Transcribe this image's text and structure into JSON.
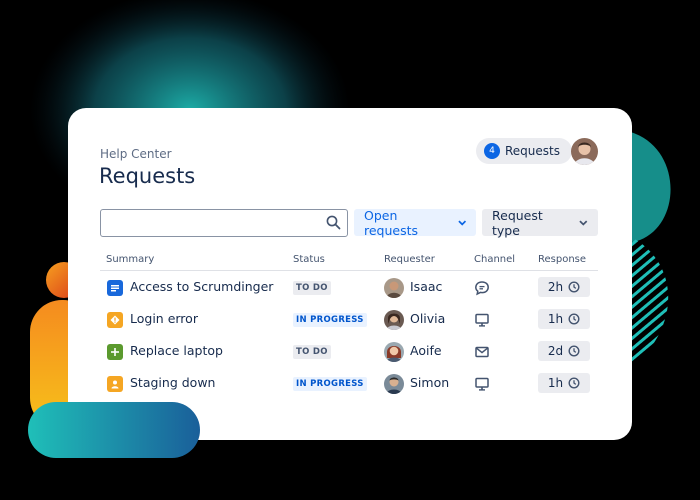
{
  "header": {
    "breadcrumb": "Help Center",
    "title": "Requests",
    "requests_count": "4",
    "requests_label": "Requests"
  },
  "filters": {
    "search_placeholder": "",
    "open_requests": "Open requests",
    "request_type": "Request type"
  },
  "table": {
    "columns": {
      "summary": "Summary",
      "status": "Status",
      "requester": "Requester",
      "channel": "Channel",
      "response": "Response"
    },
    "rows": [
      {
        "summary": "Access to Scrumdinger",
        "type_icon": "service-request-icon",
        "type_color": "#1868db",
        "status": "TO DO",
        "status_kind": "todo",
        "requester": "Isaac",
        "channel": "chat-icon",
        "response": "2h"
      },
      {
        "summary": "Login error",
        "type_icon": "incident-icon",
        "type_color": "#f5a623",
        "status": "IN PROGRESS",
        "status_kind": "progress",
        "requester": "Olivia",
        "channel": "desktop-icon",
        "response": "1h"
      },
      {
        "summary": "Replace laptop",
        "type_icon": "new-feature-icon",
        "type_color": "#5b9a2e",
        "status": "TO DO",
        "status_kind": "todo",
        "requester": "Aoife",
        "channel": "email-icon",
        "response": "2d"
      },
      {
        "summary": "Staging down",
        "type_icon": "problem-icon",
        "type_color": "#f5a623",
        "status": "IN PROGRESS",
        "status_kind": "progress",
        "requester": "Simon",
        "channel": "desktop-icon",
        "response": "1h"
      }
    ]
  },
  "colors": {
    "accent": "#0c66e4",
    "teal": "#1fbfb8",
    "orange": "#f58b1f"
  }
}
